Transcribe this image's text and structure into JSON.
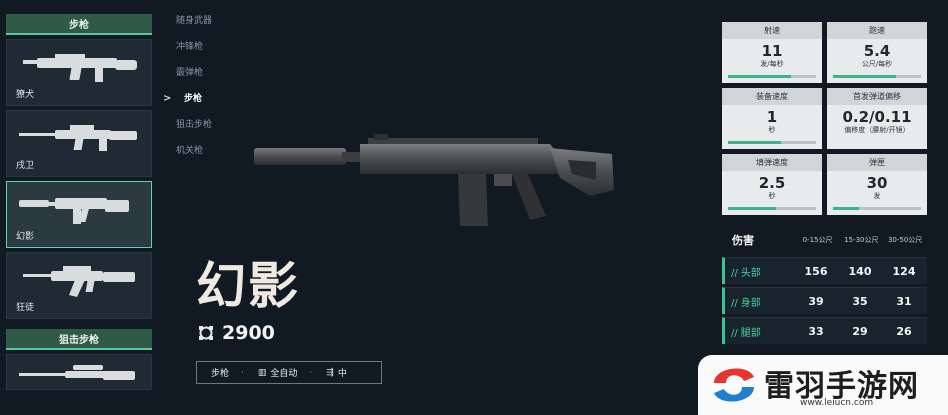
{
  "sidebar": {
    "rifle_header": "步枪",
    "sniper_header": "狙击步枪",
    "weapons": [
      {
        "name": "獠犬"
      },
      {
        "name": "戌卫"
      },
      {
        "name": "幻影"
      },
      {
        "name": "狂徒"
      }
    ]
  },
  "menu": {
    "items": [
      {
        "label": "随身武器"
      },
      {
        "label": "冲锋枪"
      },
      {
        "label": "霰弹枪"
      },
      {
        "label": "步枪"
      },
      {
        "label": "狙击步枪"
      },
      {
        "label": "机关枪"
      }
    ],
    "active_index": 3,
    "chevron": ">"
  },
  "weapon": {
    "name": "幻影",
    "price": "2900",
    "tags": [
      {
        "label": "步枪"
      },
      {
        "label": "全自动"
      },
      {
        "label": "中"
      }
    ]
  },
  "stats": [
    {
      "label": "射速",
      "value": "11",
      "unit": "发/每秒",
      "fill": 0.72
    },
    {
      "label": "跑速",
      "value": "5.4",
      "unit": "公尺/每秒",
      "fill": 0.72
    },
    {
      "label": "装备速度",
      "value": "1",
      "unit": "秒",
      "fill": 0.6
    },
    {
      "label": "首发弹道偏移",
      "value": "0.2/0.11",
      "unit": "偏移度（腰射/开镜）",
      "fill": 0.0
    },
    {
      "label": "填弹速度",
      "value": "2.5",
      "unit": "秒",
      "fill": 0.55
    },
    {
      "label": "弹匣",
      "value": "30",
      "unit": "发",
      "fill": 0.3
    }
  ],
  "damage": {
    "title": "伤害",
    "ranges": [
      "0-15公尺",
      "15-30公尺",
      "30-50公尺"
    ],
    "rows": [
      {
        "part": "头部",
        "values": [
          "156",
          "140",
          "124"
        ]
      },
      {
        "part": "身部",
        "values": [
          "39",
          "35",
          "31"
        ]
      },
      {
        "part": "腿部",
        "values": [
          "33",
          "29",
          "26"
        ]
      }
    ]
  },
  "watermark": {
    "name": "雷羽手游网",
    "url": "www.leiucn.com"
  },
  "colors": {
    "background": "#111a23",
    "accent": "#3bb48c",
    "damage_accent": "#44d39f",
    "category_header": "#2f5a46",
    "logo_red": "#e8342f",
    "logo_blue": "#1f7fd0"
  },
  "icons": {
    "price": "creds-icon",
    "fire_mode": "full-auto-icon",
    "wall_pen": "wall-penetration-icon"
  }
}
